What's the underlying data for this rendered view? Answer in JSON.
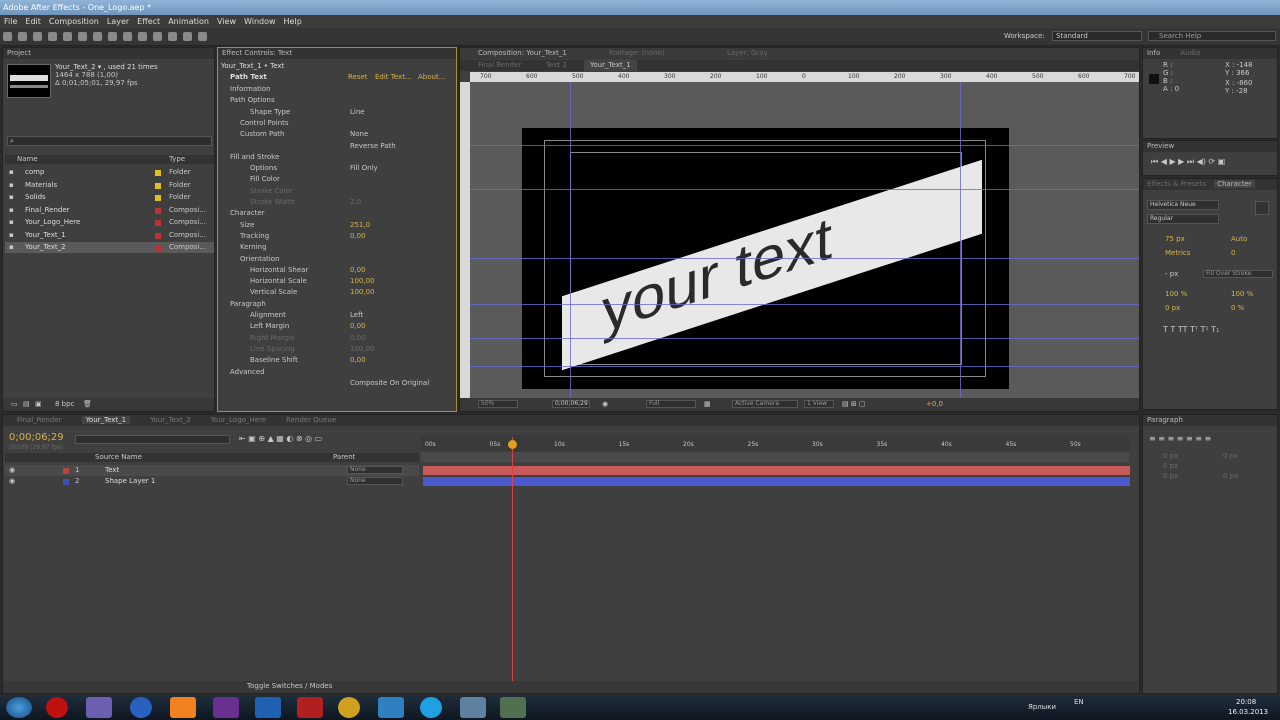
{
  "window": {
    "title": "Adobe After Effects - One_Logo.aep *"
  },
  "menu": [
    "File",
    "Edit",
    "Composition",
    "Layer",
    "Effect",
    "Animation",
    "View",
    "Window",
    "Help"
  ],
  "toolbar": {
    "workspace_label": "Workspace:",
    "workspace_value": "Standard",
    "search_placeholder": "Search Help"
  },
  "project": {
    "tab": "Project",
    "selected_name": "Your_Text_2 ▾ , used 21 times",
    "selected_info1": "1464 x 788 (1,00)",
    "selected_info2": "Δ 0;01;05;01, 29,97 fps",
    "col_name": "Name",
    "col_type": "Type",
    "items": [
      {
        "name": "comp",
        "type": "Folder",
        "color": "#e0c020"
      },
      {
        "name": "Materials",
        "type": "Folder",
        "color": "#e0c020"
      },
      {
        "name": "Solids",
        "type": "Folder",
        "color": "#e0c020"
      },
      {
        "name": "Final_Render",
        "type": "Composi...",
        "color": "#c03030"
      },
      {
        "name": "Your_Logo_Here",
        "type": "Composi...",
        "color": "#c03030"
      },
      {
        "name": "Your_Text_1",
        "type": "Composi...",
        "color": "#c03030"
      },
      {
        "name": "Your_Text_2",
        "type": "Composi...",
        "color": "#c03030"
      }
    ],
    "bpc": "8 bpc"
  },
  "effects": {
    "tab": "Effect Controls: Text",
    "layer": "Your_Text_1 • Text",
    "effect_name": "Path Text",
    "reset": "Reset",
    "edit": "Edit Text...",
    "about": "About...",
    "rows": [
      {
        "label": "Information",
        "value": ""
      },
      {
        "label": "Path Options",
        "value": ""
      },
      {
        "label": "Shape Type",
        "value": "Line"
      },
      {
        "label": "Control Points",
        "value": ""
      },
      {
        "label": "Custom Path",
        "value": "None"
      },
      {
        "label": "",
        "value": "Reverse Path"
      },
      {
        "label": "Fill and Stroke",
        "value": ""
      },
      {
        "label": "Options",
        "value": "Fill Only"
      },
      {
        "label": "Fill Color",
        "value": ""
      },
      {
        "label": "Stroke Color",
        "value": ""
      },
      {
        "label": "Stroke Width",
        "value": "2,0"
      },
      {
        "label": "Character",
        "value": ""
      },
      {
        "label": "Size",
        "value": "251,0"
      },
      {
        "label": "Tracking",
        "value": "0,00"
      },
      {
        "label": "Kerning",
        "value": ""
      },
      {
        "label": "Orientation",
        "value": ""
      },
      {
        "label": "Horizontal Shear",
        "value": "0,00"
      },
      {
        "label": "Horizontal Scale",
        "value": "100,00"
      },
      {
        "label": "Vertical Scale",
        "value": "100,00"
      },
      {
        "label": "Paragraph",
        "value": ""
      },
      {
        "label": "Alignment",
        "value": "Left"
      },
      {
        "label": "Left Margin",
        "value": "0,00"
      },
      {
        "label": "Right Margin",
        "value": "0,00"
      },
      {
        "label": "Line Spacing",
        "value": "100,00"
      },
      {
        "label": "Baseline Shift",
        "value": "0,00"
      },
      {
        "label": "Advanced",
        "value": ""
      },
      {
        "label": "",
        "value": "Composite On Original"
      }
    ]
  },
  "comp": {
    "tab": "Composition: Your_Text_1",
    "footage": "Footage: (none)",
    "layer": "Layer: Gray",
    "subtabs": [
      "Final Render",
      "Text 2",
      "Your_Text_1"
    ],
    "canvas_text": "your text",
    "ruler": [
      "700",
      "600",
      "500",
      "400",
      "300",
      "200",
      "100",
      "0",
      "100",
      "200",
      "300",
      "400",
      "500",
      "600",
      "700"
    ],
    "zoom": "50%",
    "timecode": "0;00;06;29",
    "quality": "Full",
    "camera": "Active Camera",
    "views": "1 View",
    "exposure": "+0,0"
  },
  "info": {
    "tab": "Info",
    "tab2": "Audio",
    "r": "R :",
    "g": "G :",
    "b": "B :",
    "a": "A : 0",
    "x": "X : -148",
    "y": "Y : 366",
    "x2": "X : -860",
    "y2": "Y : -28"
  },
  "preview": {
    "tab": "Preview"
  },
  "character": {
    "tab1": "Effects & Presets",
    "tab2": "Character",
    "font": "Helvetica Neue",
    "style": "Regular",
    "size": "75 px",
    "leading": "Auto",
    "kerning": "Metrics",
    "tracking": "0",
    "stroke": "- px",
    "stroke_mode": "Fill Over Stroke",
    "vscale": "100 %",
    "hscale": "100 %",
    "baseline": "0 px",
    "tsume": "0 %"
  },
  "paragraph": {
    "tab": "Paragraph",
    "v1": "0 px",
    "v2": "0 px",
    "v3": "0 px",
    "v4": "0 px",
    "v5": "0 px"
  },
  "timeline": {
    "tabs": [
      "Final_Render",
      "Your_Text_1",
      "Your_Text_2",
      "Your_Logo_Here",
      "Render Queue"
    ],
    "timecode": "0;00;06;29",
    "frames": "00209 (29.97 fps)",
    "col_source": "Source Name",
    "col_parent": "Parent",
    "layers": [
      {
        "num": "1",
        "name": "Text",
        "parent": "None",
        "color": "#c04040"
      },
      {
        "num": "2",
        "name": "Shape Layer 1",
        "parent": "None",
        "color": "#4050b0"
      }
    ],
    "ticks": [
      "00s",
      "05s",
      "10s",
      "15s",
      "20s",
      "25s",
      "30s",
      "35s",
      "40s",
      "45s",
      "50s"
    ],
    "toggle": "Toggle Switches / Modes"
  },
  "taskbar": {
    "lang1": "Ярлыки",
    "lang2": "EN",
    "time": "20:08",
    "date": "16.03.2013"
  }
}
